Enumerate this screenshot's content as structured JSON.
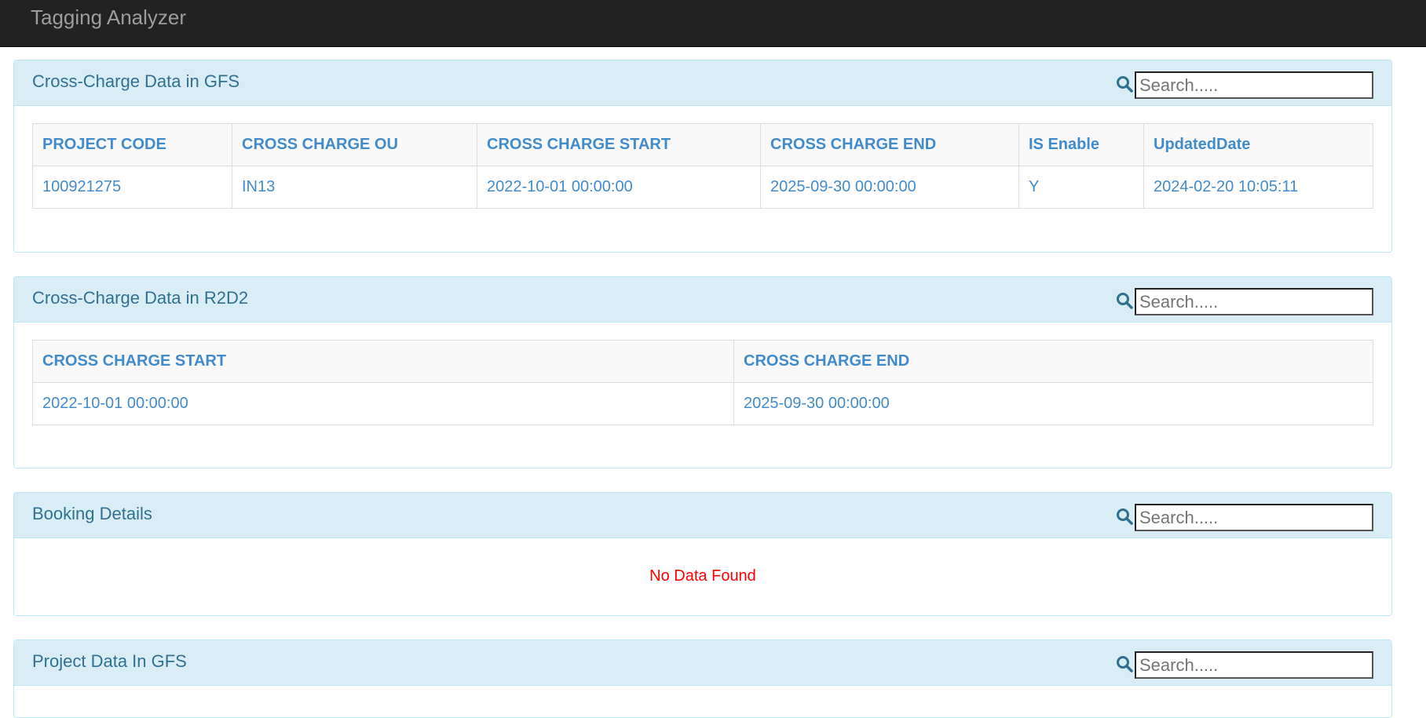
{
  "app": {
    "title": "Tagging Analyzer"
  },
  "panels": {
    "gfs": {
      "title": "Cross-Charge Data in GFS",
      "search_placeholder": "Search.....",
      "headers": [
        "PROJECT CODE",
        "CROSS CHARGE OU",
        "CROSS CHARGE START",
        "CROSS CHARGE END",
        "IS Enable",
        "UpdatedDate"
      ],
      "row": [
        "100921275",
        "IN13",
        "2022-10-01 00:00:00",
        "2025-09-30 00:00:00",
        "Y",
        "2024-02-20 10:05:11"
      ]
    },
    "r2d2": {
      "title": "Cross-Charge Data in R2D2",
      "search_placeholder": "Search.....",
      "headers": [
        "CROSS CHARGE START",
        "CROSS CHARGE END"
      ],
      "row": [
        "2022-10-01 00:00:00",
        "2025-09-30 00:00:00"
      ]
    },
    "booking": {
      "title": "Booking Details",
      "search_placeholder": "Search.....",
      "empty_message": "No Data Found"
    },
    "project": {
      "title": "Project Data In GFS",
      "search_placeholder": "Search....."
    }
  },
  "colors": {
    "navbar_bg": "#222222",
    "panel_heading_bg": "#d9edf7",
    "panel_title": "#31708f",
    "table_text": "#428bca",
    "empty_text": "#ff0000"
  },
  "icons": {
    "search": "search-icon"
  }
}
